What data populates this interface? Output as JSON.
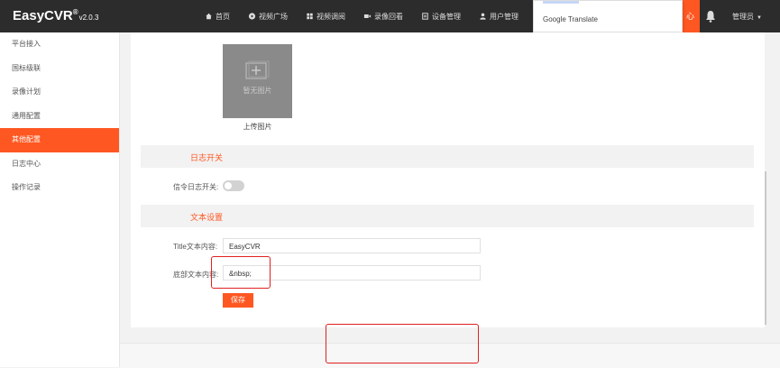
{
  "header": {
    "logo": "EasyCVR",
    "logo_reg": "®",
    "version": "v2.0.3",
    "nav": [
      {
        "label": "首页",
        "icon": "home-icon"
      },
      {
        "label": "视频广场",
        "icon": "play-circle-icon"
      },
      {
        "label": "视频调阅",
        "icon": "grid-icon"
      },
      {
        "label": "录像回看",
        "icon": "video-camera-icon"
      },
      {
        "label": "设备管理",
        "icon": "device-icon"
      },
      {
        "label": "用户管理",
        "icon": "user-icon"
      }
    ],
    "orange_tab_fragment": "心",
    "user": "管理员"
  },
  "translate_popup": {
    "label": "Google Translate"
  },
  "sidebar": {
    "items": [
      {
        "label": "平台接入",
        "active": false
      },
      {
        "label": "国标级联",
        "active": false
      },
      {
        "label": "录像计划",
        "active": false
      },
      {
        "label": "通用配置",
        "active": false
      },
      {
        "label": "其他配置",
        "active": true
      },
      {
        "label": "日志中心",
        "active": false
      },
      {
        "label": "操作记录",
        "active": false
      }
    ]
  },
  "main": {
    "image_section": {
      "placeholder_text": "暂无图片",
      "upload_label": "上传图片"
    },
    "log_section": {
      "title": "日志开关",
      "signal_log_label": "信令日志开关:"
    },
    "text_section": {
      "title": "文本设置",
      "title_text_label": "Title文本内容:",
      "title_text_value": "EasyCVR",
      "footer_text_label": "底部文本内容:",
      "footer_text_value": "&nbsp;",
      "save_label": "保存"
    }
  },
  "colors": {
    "accent": "#ff5722",
    "topbar": "#2c2c2c",
    "annotation": "#e02020"
  }
}
